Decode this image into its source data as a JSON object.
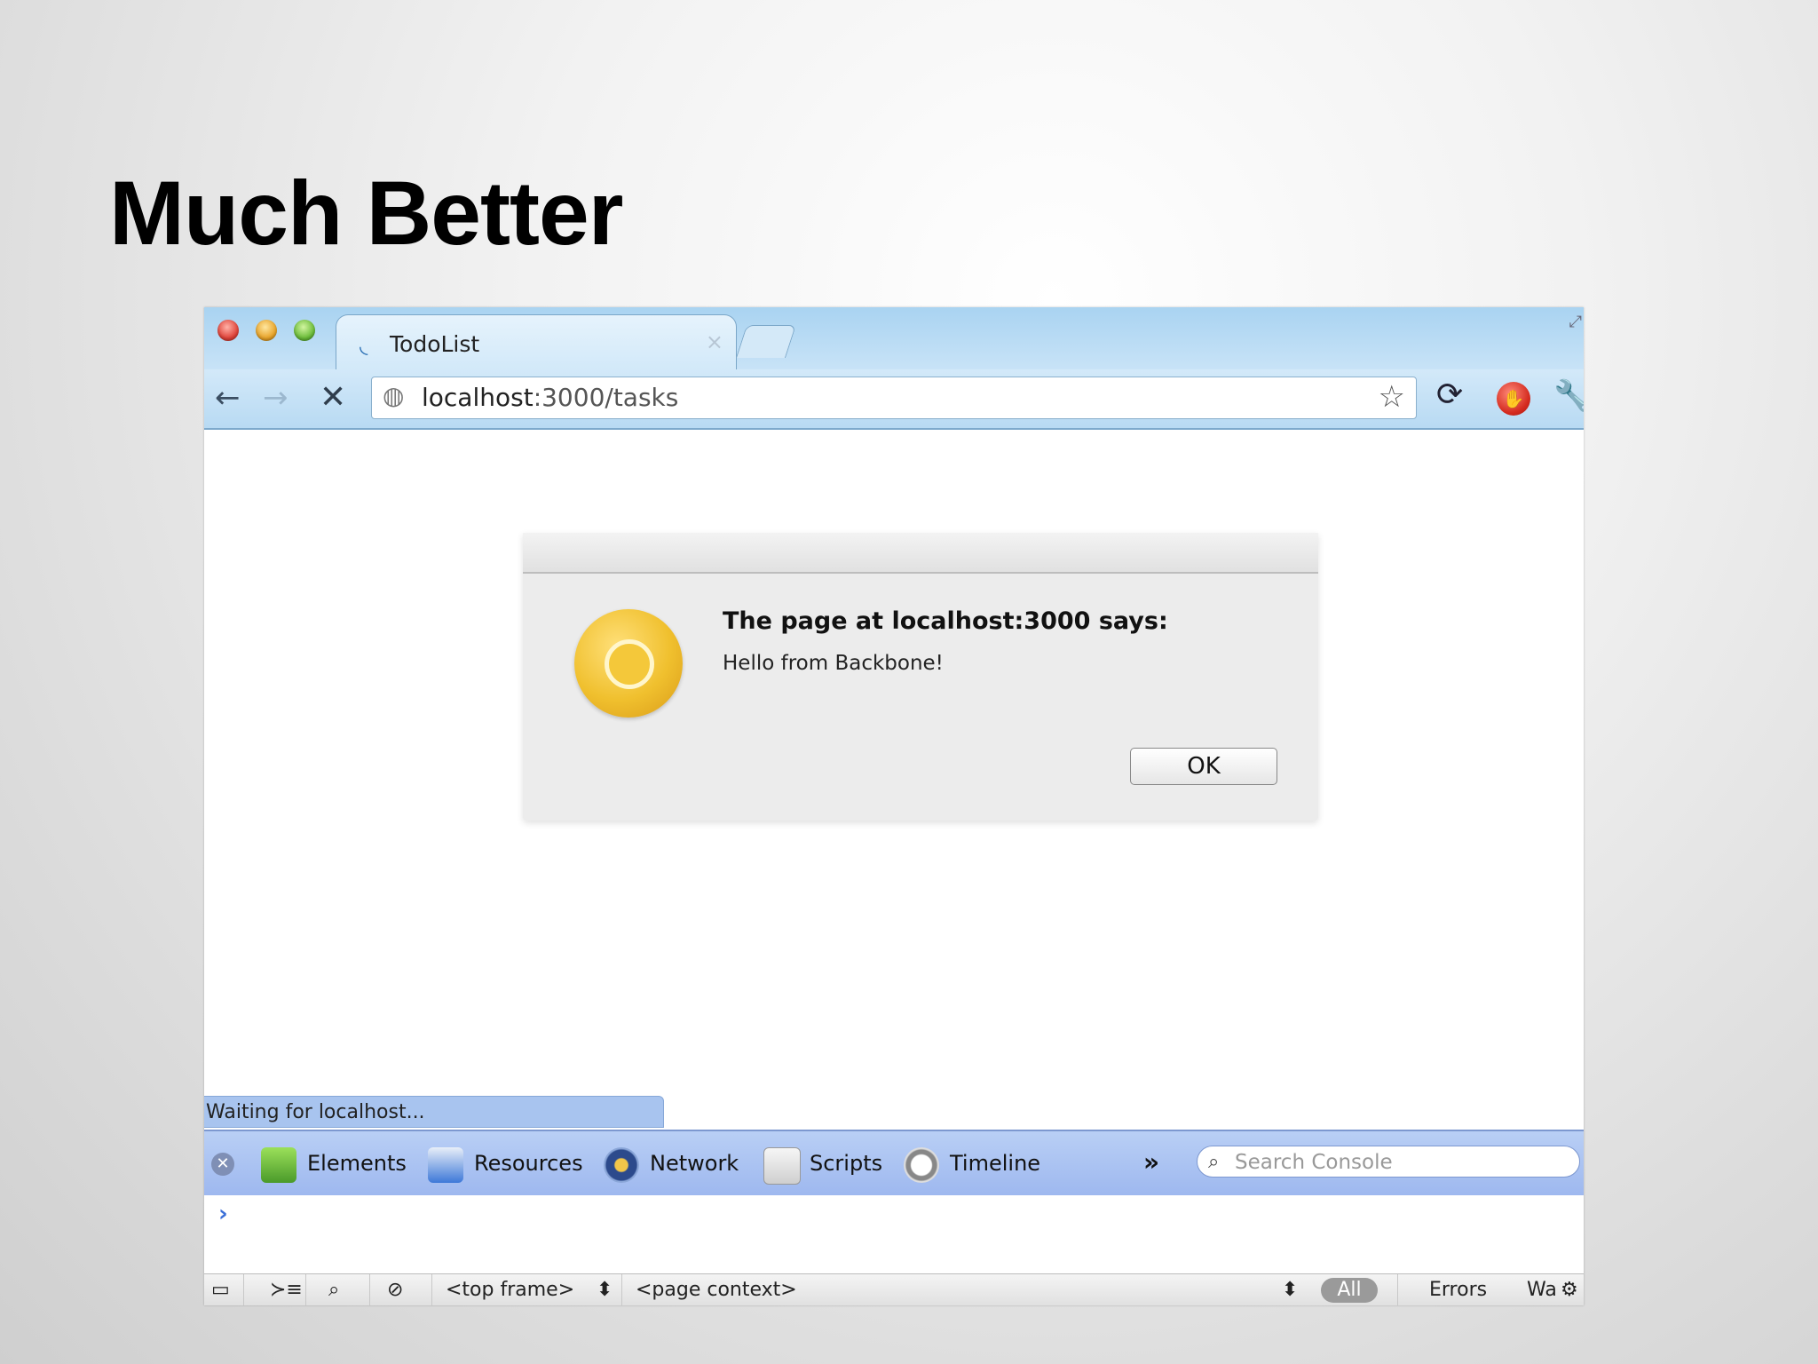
{
  "slide": {
    "title": "Much Better"
  },
  "browser": {
    "tab": {
      "title": "TodoList",
      "close_glyph": "×"
    },
    "nav": {
      "back_glyph": "←",
      "forward_glyph": "→",
      "stop_glyph": "✕"
    },
    "omnibox": {
      "host": "localhost",
      "rest": ":3000/tasks"
    },
    "icons": [
      "globe-icon",
      "star-icon",
      "sync-icon",
      "stop-extension-icon",
      "wrench-icon"
    ]
  },
  "dialog": {
    "heading": "The page at localhost:3000 says:",
    "message": "Hello from Backbone!",
    "ok_label": "OK"
  },
  "status": {
    "text": "Waiting for localhost..."
  },
  "devtools": {
    "tabs": [
      {
        "label": "Elements"
      },
      {
        "label": "Resources"
      },
      {
        "label": "Network"
      },
      {
        "label": "Scripts"
      },
      {
        "label": "Timeline"
      }
    ],
    "more_glyph": "»",
    "search_placeholder": "Search Console",
    "prompt_glyph": "›"
  },
  "console_bar": {
    "frame_select": "<top frame>",
    "context_select": "<page context>",
    "filters": {
      "all": "All",
      "errors": "Errors",
      "warnings": "Wa"
    }
  },
  "colors": {
    "chrome_blue": "#b8daf3",
    "devtools_blue": "#9eb8ef",
    "dialog_bg": "#ececec"
  }
}
